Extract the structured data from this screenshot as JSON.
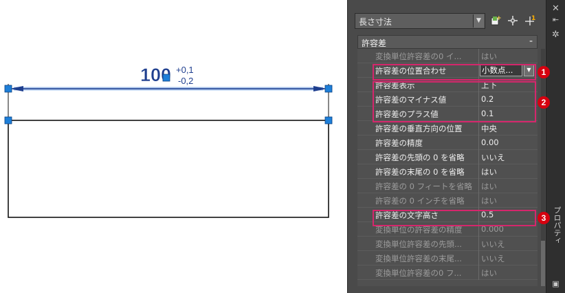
{
  "drawing": {
    "dimension_value": "100",
    "tolerance_plus": "+0,1",
    "tolerance_minus": "-0,2"
  },
  "palette": {
    "title_vertical": "プロパティ",
    "selector": "長さ寸法",
    "group_title": "許容差",
    "group_toggle": "-",
    "rows": [
      {
        "name": "変換単位許容差の0 イ...",
        "value": "はい",
        "dim": true
      },
      {
        "name": "許容差の位置合わせ",
        "value": "小数点...",
        "dim": false,
        "dropdown": true
      },
      {
        "name": "許容差表示",
        "value": "上下",
        "dim": false
      },
      {
        "name": "許容差のマイナス値",
        "value": "0.2",
        "dim": false
      },
      {
        "name": "許容差のプラス値",
        "value": "0.1",
        "dim": false
      },
      {
        "name": "許容差の垂直方向の位置",
        "value": "中央",
        "dim": false
      },
      {
        "name": "許容差の精度",
        "value": "0.00",
        "dim": false
      },
      {
        "name": "許容差の先頭の 0 を省略",
        "value": "いいえ",
        "dim": false
      },
      {
        "name": "許容差の末尾の 0 を省略",
        "value": "はい",
        "dim": false
      },
      {
        "name": "許容差の 0 フィートを省略",
        "value": "はい",
        "dim": true
      },
      {
        "name": "許容差の 0 インチを省略",
        "value": "はい",
        "dim": true
      },
      {
        "name": "許容差の文字高さ",
        "value": "0.5",
        "dim": false
      },
      {
        "name": "変換単位の許容差の精度",
        "value": "0.000",
        "dim": true
      },
      {
        "name": "変換単位許容差の先頭...",
        "value": "いいえ",
        "dim": true
      },
      {
        "name": "変換単位許容差の末尾...",
        "value": "いいえ",
        "dim": true
      },
      {
        "name": "変換単位許容差の0 フ...",
        "value": "はい",
        "dim": true
      }
    ]
  },
  "callouts": [
    "1",
    "2",
    "3"
  ],
  "colors": {
    "callout": "#d6000f",
    "highlight": "#d6266c",
    "grip": "#1e7fd8"
  }
}
